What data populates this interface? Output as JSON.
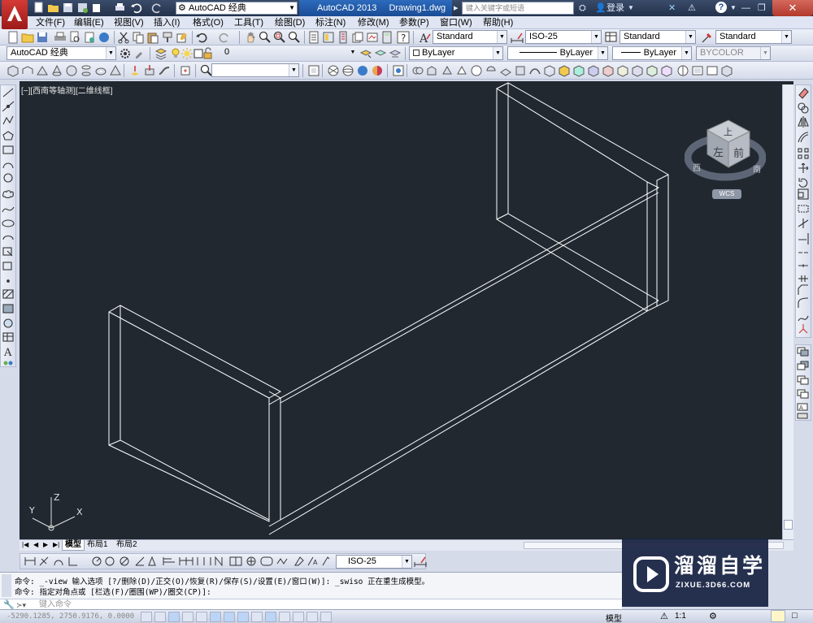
{
  "titlebar": {
    "workspace": "AutoCAD 经典",
    "app_name": "AutoCAD 2013",
    "file_name": "Drawing1.dwg",
    "search_placeholder": "键入关键字或短语",
    "login": "登录"
  },
  "menu": [
    "文件(F)",
    "编辑(E)",
    "视图(V)",
    "插入(I)",
    "格式(O)",
    "工具(T)",
    "绘图(D)",
    "标注(N)",
    "修改(M)",
    "参数(P)",
    "窗口(W)",
    "帮助(H)"
  ],
  "styles": {
    "text_style": "Standard",
    "dim_style": "ISO-25",
    "table_style": "Standard",
    "multileader_style": "Standard"
  },
  "workspace_combo": "AutoCAD 经典",
  "layer_combo": "0",
  "properties": {
    "color": "ByLayer",
    "linetype": "ByLayer",
    "lineweight": "ByLayer",
    "plotstyle": "BYCOLOR"
  },
  "viewport": {
    "label": "[−][西南等轴测][二维线框]",
    "viewcube": {
      "top": "上",
      "left": "左",
      "front": "前",
      "west": "西",
      "south": "南",
      "wcs": "WCS"
    },
    "ucs": {
      "x": "X",
      "y": "Y",
      "z": "Z"
    }
  },
  "layout_tabs": [
    "模型",
    "布局1",
    "布局2"
  ],
  "dim_style_bottom": "ISO-25",
  "command": {
    "line1": "命令: _-view 输入选项 [?/删除(D)/正交(O)/恢复(R)/保存(S)/设置(E)/窗口(W)]: _swiso 正在重生成模型。",
    "line2": "命令: 指定对角点或 [栏选(F)/圈围(WP)/圈交(CP)]:",
    "input_placeholder": "键入命令"
  },
  "status": {
    "coords": "-5290.1285, 2750.9176, 0.0000",
    "model": "模型",
    "scale": "1:1"
  },
  "watermark": {
    "title": "溜溜自学",
    "url": "ZIXUE.3D66.COM"
  },
  "colors": {
    "viewport_bg": "#212830",
    "wire": "#ffffff",
    "titlebar": "#2a3854",
    "watermark_bg": "#182242"
  }
}
